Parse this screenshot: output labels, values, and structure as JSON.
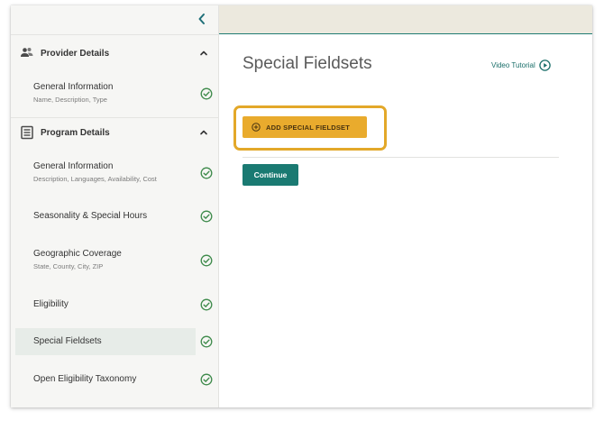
{
  "sidebar": {
    "collapse_icon": "chevron-left-icon",
    "sections": [
      {
        "label": "Provider Details",
        "icon": "people-icon",
        "items": [
          {
            "title": "General Information",
            "subtitle": "Name, Description, Type",
            "status": "complete"
          }
        ]
      },
      {
        "label": "Program Details",
        "icon": "document-icon",
        "items": [
          {
            "title": "General Information",
            "subtitle": "Description, Languages, Availability, Cost",
            "status": "complete"
          },
          {
            "title": "Seasonality & Special Hours",
            "subtitle": "",
            "status": "complete"
          },
          {
            "title": "Geographic Coverage",
            "subtitle": "State, County, City, ZIP",
            "status": "complete"
          },
          {
            "title": "Eligibility",
            "subtitle": "",
            "status": "complete"
          },
          {
            "title": "Special Fieldsets",
            "subtitle": "",
            "status": "complete",
            "active": true
          },
          {
            "title": "Open Eligibility Taxonomy",
            "subtitle": "",
            "status": "complete"
          }
        ]
      }
    ]
  },
  "main": {
    "title": "Special Fieldsets",
    "video_link": "Video Tutorial",
    "add_button": "ADD SPECIAL FIELDSET",
    "continue_button": "Continue"
  },
  "colors": {
    "accent_teal": "#1a7a72",
    "accent_gold": "#e9ab2d",
    "highlight_ring": "#e3a829",
    "check_green": "#3d8a4a",
    "topbar_bg": "#ece9de",
    "sidebar_bg": "#f6f6f4"
  }
}
